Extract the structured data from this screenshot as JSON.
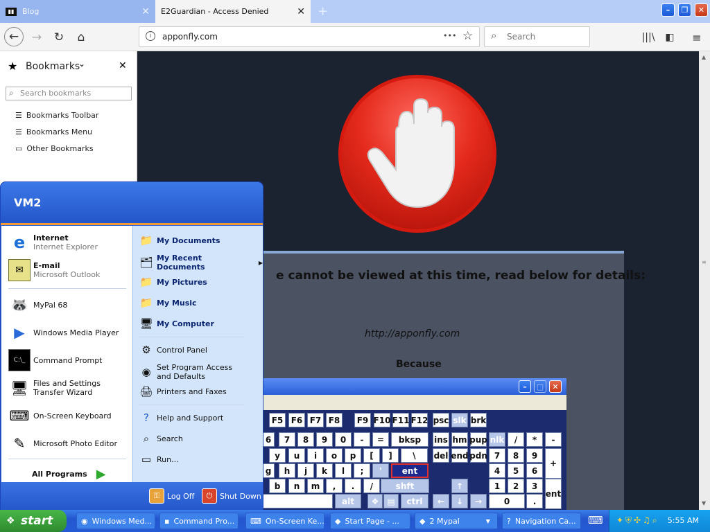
{
  "browser": {
    "tabs": [
      {
        "title": "Blog",
        "close": "✕"
      },
      {
        "title": "E2Guardian - Access Denied",
        "close": "✕"
      }
    ],
    "new_tab": "+",
    "window_buttons": {
      "minimize": "–",
      "restore": "❐",
      "close": "✕"
    },
    "url": "apponfly.com",
    "url_dots": "•••",
    "search_placeholder": "Search"
  },
  "sidebar": {
    "title": "Bookmarks",
    "chevron": "⌄",
    "close": "✕",
    "search_placeholder": "Search bookmarks",
    "items": [
      "Bookmarks Toolbar",
      "Bookmarks Menu",
      "Other Bookmarks"
    ]
  },
  "page": {
    "message": "e cannot be viewed at this time, read below for details:",
    "url": "http://apponfly.com",
    "because": "Because"
  },
  "osk": {
    "row_f": [
      "F5",
      "F6",
      "F7",
      "F8",
      "F9",
      "F10",
      "F11",
      "F12",
      "psc",
      "slk",
      "brk"
    ],
    "row1": [
      "6",
      "7",
      "8",
      "9",
      "0",
      "-",
      "=",
      "bksp",
      "ins",
      "hm",
      "pup",
      "nlk",
      "/",
      "*",
      "-"
    ],
    "row2": [
      "y",
      "u",
      "i",
      "o",
      "p",
      "[",
      "]",
      "\\",
      "del",
      "end",
      "pdn",
      "7",
      "8",
      "9",
      "+"
    ],
    "row3": [
      "g",
      "h",
      "j",
      "k",
      "l",
      ";",
      "'",
      "ent",
      "4",
      "5",
      "6"
    ],
    "row4": [
      "b",
      "n",
      "m",
      ",",
      ".",
      "/",
      "shft",
      "↑",
      "1",
      "2",
      "3",
      "ent"
    ],
    "row5": [
      "alt",
      "ctrl",
      "←",
      "↓",
      "→",
      "0",
      "."
    ]
  },
  "start_menu": {
    "user": "VM2",
    "pinned": [
      {
        "name": "Internet",
        "sub": "Internet Explorer"
      },
      {
        "name": "E-mail",
        "sub": "Microsoft Outlook"
      }
    ],
    "recent": [
      "MyPal 68",
      "Windows Media Player",
      "Command Prompt",
      "Files and Settings Transfer Wizard",
      "On-Screen Keyboard",
      "Microsoft Photo Editor"
    ],
    "all_programs": "All Programs",
    "places": [
      "My Documents",
      "My Recent Documents",
      "My Pictures",
      "My Music",
      "My Computer"
    ],
    "system": [
      "Control Panel",
      "Set Program Access and Defaults",
      "Printers and Faxes"
    ],
    "help": [
      "Help and Support",
      "Search",
      "Run..."
    ],
    "log_off": "Log Off",
    "shut_down": "Shut Down"
  },
  "taskbar": {
    "start": "start",
    "tasks": [
      "Windows Med...",
      "Command Pro...",
      "On-Screen Ke...",
      "Start Page - ...",
      "2 Mypal",
      "Navigation Ca..."
    ],
    "clock": "5:55 AM"
  }
}
